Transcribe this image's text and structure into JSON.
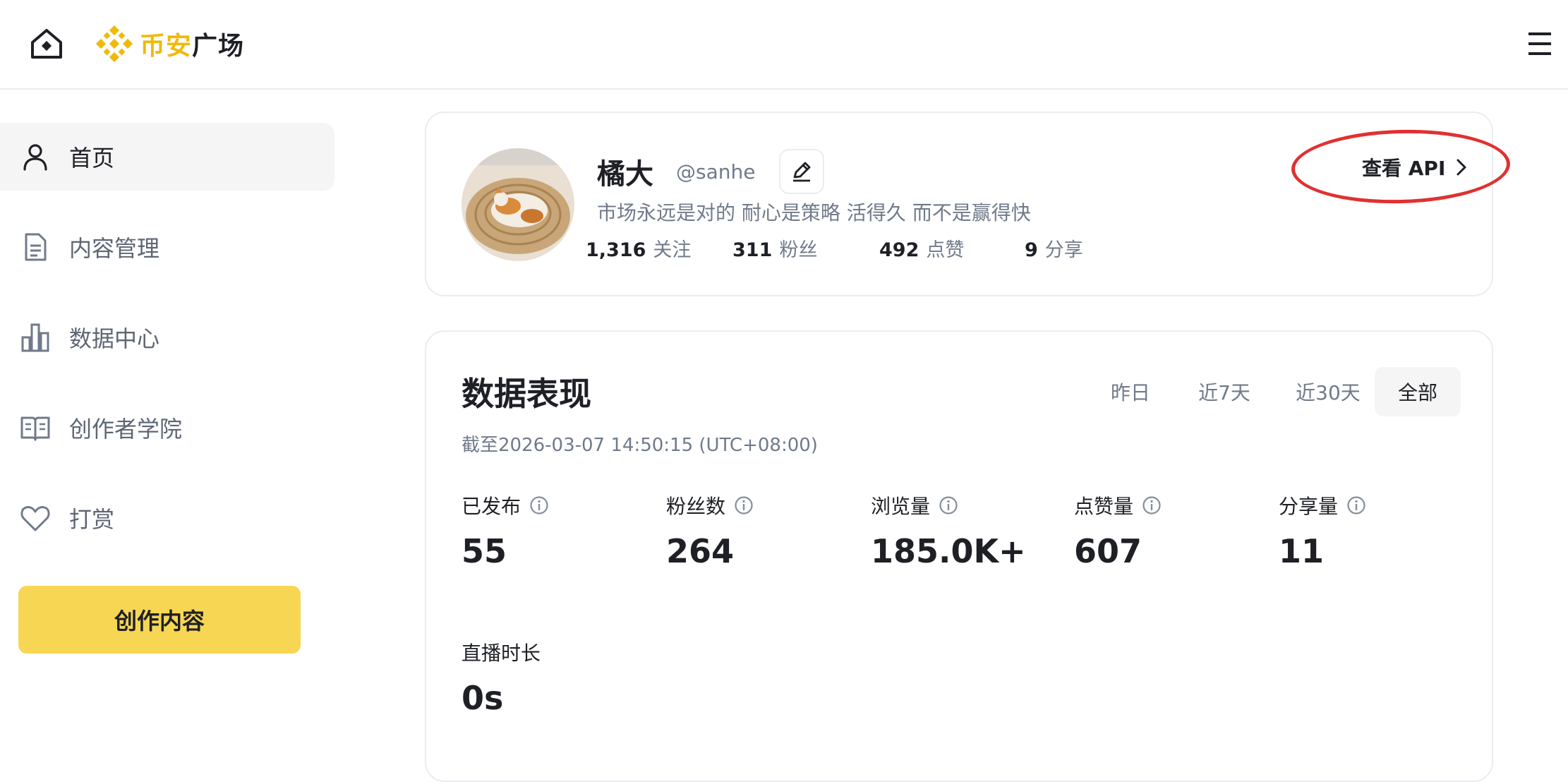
{
  "header": {
    "logo_text_brand": "币安",
    "logo_text_suffix": "广场",
    "colors": {
      "brand": "#f0b90b",
      "text": "#1e2026"
    }
  },
  "sidebar": {
    "items": [
      {
        "label": "首页",
        "icon": "person-icon",
        "active": true
      },
      {
        "label": "内容管理",
        "icon": "document-icon",
        "active": false
      },
      {
        "label": "数据中心",
        "icon": "bar-chart-icon",
        "active": false
      },
      {
        "label": "创作者学院",
        "icon": "book-icon",
        "active": false
      },
      {
        "label": "打赏",
        "icon": "heart-icon",
        "active": false
      }
    ],
    "create_button": "创作内容",
    "create_button_color": "#f7d654"
  },
  "profile": {
    "name": "橘大",
    "handle": "@sanhe",
    "bio": "市场永远是对的 耐心是策略 活得久 而不是赢得快",
    "stats": [
      {
        "value": "1,316",
        "label": "关注"
      },
      {
        "value": "311",
        "label": "粉丝"
      },
      {
        "value": "492",
        "label": "点赞"
      },
      {
        "value": "9",
        "label": "分享"
      }
    ],
    "api_link": "查看 API",
    "highlight_color": "#e03131"
  },
  "performance": {
    "title": "数据表现",
    "as_of": "截至2026-03-07 14:50:15 (UTC+08:00)",
    "ranges": [
      {
        "label": "昨日",
        "active": false
      },
      {
        "label": "近7天",
        "active": false
      },
      {
        "label": "近30天",
        "active": false
      },
      {
        "label": "全部",
        "active": true
      }
    ],
    "metrics": [
      {
        "label": "已发布",
        "value": "55",
        "info": true
      },
      {
        "label": "粉丝数",
        "value": "264",
        "info": true
      },
      {
        "label": "浏览量",
        "value": "185.0K+",
        "info": true
      },
      {
        "label": "点赞量",
        "value": "607",
        "info": true
      },
      {
        "label": "分享量",
        "value": "11",
        "info": true
      },
      {
        "label": "直播时长",
        "value": "0s",
        "info": false
      }
    ]
  }
}
